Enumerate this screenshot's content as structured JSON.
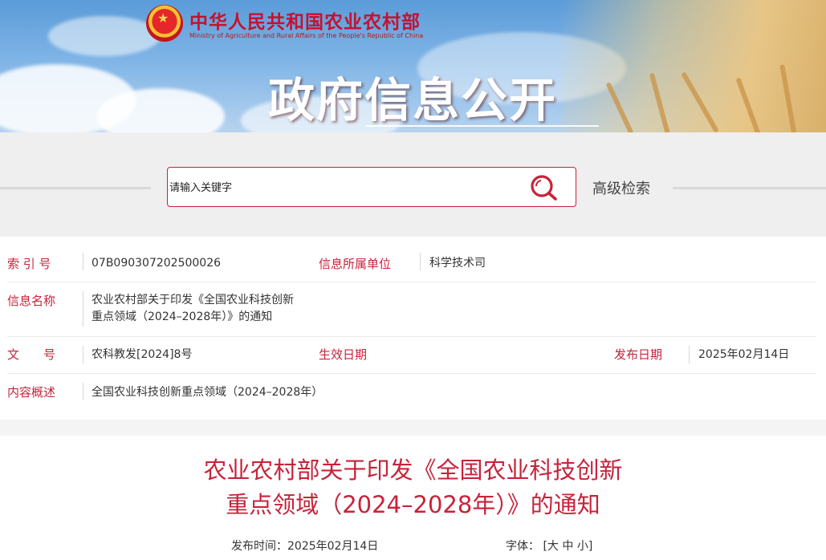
{
  "header": {
    "ministry_cn": "中华人民共和国农业农村部",
    "ministry_en": "Ministry of Agriculture and Rural Affairs of the People's Republic of China",
    "banner_title": "政府信息公开"
  },
  "search": {
    "placeholder": "请输入关键字",
    "advanced_label": "高级检索"
  },
  "info": {
    "index_label": "索 引 号",
    "index_value": "07B090307202500026",
    "unit_label": "信息所属单位",
    "unit_value": "科学技术司",
    "name_label": "信息名称",
    "name_value_line1": "农业农村部关于印发《全国农业科技创新",
    "name_value_line2": "重点领域（2024–2028年）》的通知",
    "docno_label": "文　　号",
    "docno_value": "农科教发[2024]8号",
    "effective_label": "生效日期",
    "effective_value": "",
    "publish_label": "发布日期",
    "publish_value": "2025年02月14日",
    "summary_label": "内容概述",
    "summary_value": "全国农业科技创新重点领域（2024–2028年）"
  },
  "article": {
    "title_line1": "农业农村部关于印发《全国农业科技创新",
    "title_line2": "重点领域（2024–2028年）》的通知",
    "publish_time_label": "发布时间：",
    "publish_time_value": "2025年02月14日",
    "font_label": "字体：",
    "font_open": "[",
    "font_large": "大",
    "font_medium": "中",
    "font_small": "小",
    "font_close": "]"
  },
  "colors": {
    "accent": "#c6233a",
    "banner_sky": "#6ea8e0",
    "page_bg": "#f4f4f4"
  },
  "icons": [
    "national-emblem-icon",
    "search-icon"
  ]
}
